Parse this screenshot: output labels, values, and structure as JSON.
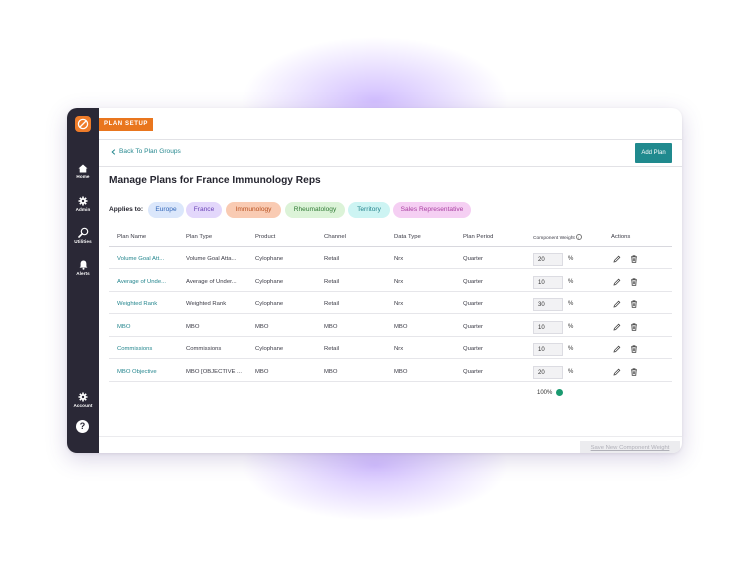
{
  "nav": {
    "tag": "PLAN SETUP",
    "items": [
      {
        "label": "Home",
        "icon": "home-icon"
      },
      {
        "label": "Admin",
        "icon": "gear-icon"
      },
      {
        "label": "Utilities",
        "icon": "wrench-icon"
      },
      {
        "label": "Alerts",
        "icon": "bell-icon"
      }
    ],
    "account": {
      "label": "Account",
      "icon": "gear-icon"
    },
    "help_label": "?"
  },
  "header": {
    "back_label": "Back To Plan Groups",
    "add_plan_label": "Add Plan"
  },
  "page": {
    "title": "Manage Plans for France Immunology Reps",
    "applies_label": "Applies to:"
  },
  "chips": [
    {
      "label": "Europe",
      "bg": "#dbe7fb",
      "fg": "#3166b8"
    },
    {
      "label": "France",
      "bg": "#e3d7fb",
      "fg": "#6a42b6"
    },
    {
      "label": "Immunology",
      "bg": "#f9cbb3",
      "fg": "#b8501f"
    },
    {
      "label": "Rheumatology",
      "bg": "#dcf3d8",
      "fg": "#2f7a34"
    },
    {
      "label": "Territory",
      "bg": "#cdf4f3",
      "fg": "#23838c"
    },
    {
      "label": "Sales Representative",
      "bg": "#f5cff3",
      "fg": "#a83ea0"
    }
  ],
  "table": {
    "headers": [
      "Plan Name",
      "Plan Type",
      "Product",
      "Channel",
      "Data Type",
      "Plan Period",
      "Component Weight",
      "Actions"
    ],
    "rows": [
      {
        "name": "Volume Goal Att...",
        "type": "Volume Goal Atta...",
        "product": "Cylophane",
        "channel": "Retail",
        "data_type": "Nrx",
        "period": "Quarter",
        "weight": "20"
      },
      {
        "name": "Average of Unde...",
        "type": "Average of Under...",
        "product": "Cylophane",
        "channel": "Retail",
        "data_type": "Nrx",
        "period": "Quarter",
        "weight": "10"
      },
      {
        "name": "Weighted Rank",
        "type": "Weighted Rank",
        "product": "Cylophane",
        "channel": "Retail",
        "data_type": "Nrx",
        "period": "Quarter",
        "weight": "30"
      },
      {
        "name": "MBO",
        "type": "MBO",
        "product": "MBO",
        "channel": "MBO",
        "data_type": "MBO",
        "period": "Quarter",
        "weight": "10"
      },
      {
        "name": "Commissions",
        "type": "Commissions",
        "product": "Cylophane",
        "channel": "Retail",
        "data_type": "Nrx",
        "period": "Quarter",
        "weight": "10"
      },
      {
        "name": "MBO Objective",
        "type": "MBO [OBJECTIVE ...",
        "product": "MBO",
        "channel": "MBO",
        "data_type": "MBO",
        "period": "Quarter",
        "weight": "20"
      }
    ],
    "percent_sign": "%",
    "total": "100%"
  },
  "footer": {
    "save_label": "Save New Component Weight"
  },
  "colors": {
    "sidebar": "#2a2836",
    "accent": "#208a8e",
    "tag": "#e9761e",
    "link": "#24868e"
  }
}
